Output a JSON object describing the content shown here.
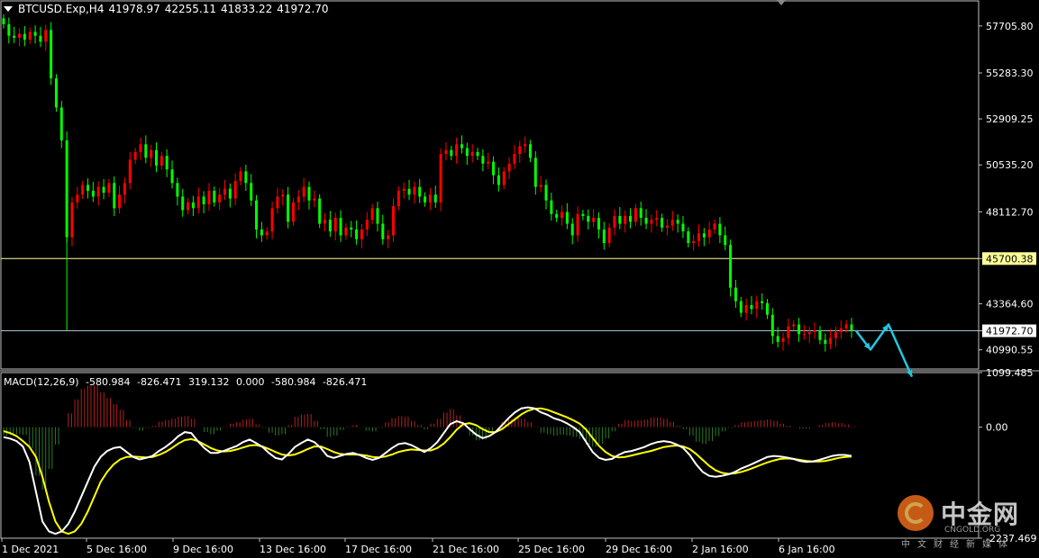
{
  "header": {
    "symbol": "BTCUSD.Exp,H4",
    "open": "41978.97",
    "high": "42255.11",
    "low": "41833.22",
    "close": "41972.70"
  },
  "macd_header": {
    "name": "MACD(12,26,9)",
    "v1": "-580.984",
    "v2": "-826.471",
    "v3": "319.132",
    "v4": "0.000",
    "v5": "-580.984",
    "v6": "-826.471"
  },
  "watermark": {
    "brand": "中金网",
    "site": "CNGOLD.ORG",
    "sub": "中文财经新媒体"
  },
  "colors": {
    "bull": "#ff0000",
    "bear": "#00ff00",
    "support": "#ffff99",
    "price_line": "#a0c0d0",
    "macd_line": "#ffffff",
    "signal_line": "#ffff00",
    "arrow": "#21c7e0",
    "axis_text": "#ffffff"
  },
  "chart_data": [
    {
      "type": "candlestick",
      "title": "BTCUSD.Exp,H4",
      "ylim": [
        40000,
        59000
      ],
      "y_ticks": [
        "57705.80",
        "55283.30",
        "52909.25",
        "50535.20",
        "48112.70",
        "45700.38",
        "43364.60",
        "41972.70",
        "40990.55"
      ],
      "y_tick_values": [
        57705.8,
        55283.3,
        52909.25,
        50535.2,
        48112.7,
        45700.38,
        43364.6,
        41972.7,
        40990.55
      ],
      "x_ticks": [
        "1 Dec 2021",
        "5 Dec 16:00",
        "9 Dec 16:00",
        "13 Dec 16:00",
        "17 Dec 16:00",
        "21 Dec 16:00",
        "25 Dec 16:00",
        "29 Dec 16:00",
        "2 Jan 16:00",
        "6 Jan 16:00"
      ],
      "support_level": 45700.38,
      "current_price": 41972.7,
      "close_series": [
        57800,
        57200,
        57100,
        57300,
        57000,
        57400,
        57200,
        56900,
        57500,
        55000,
        53500,
        51800,
        46800,
        48600,
        49000,
        49500,
        49200,
        48900,
        49400,
        49100,
        49600,
        48300,
        49000,
        49600,
        50800,
        51200,
        51600,
        50900,
        51300,
        50500,
        51000,
        50300,
        49600,
        48900,
        48200,
        48600,
        48300,
        48900,
        48500,
        49200,
        48600,
        49000,
        49300,
        48800,
        49700,
        50200,
        49600,
        48700,
        47200,
        46900,
        47100,
        48300,
        48900,
        49000,
        47600,
        48600,
        48900,
        49400,
        48700,
        48800,
        47500,
        47700,
        47100,
        47800,
        46900,
        47300,
        47200,
        46700,
        47200,
        47700,
        48300,
        47500,
        46700,
        46900,
        48400,
        49200,
        49300,
        49000,
        49400,
        48900,
        48600,
        49000,
        48600,
        51100,
        51300,
        51000,
        51600,
        51400,
        51000,
        51200,
        51000,
        50600,
        50700,
        50000,
        49500,
        50200,
        50600,
        51100,
        51500,
        51600,
        50900,
        49400,
        49500,
        48700,
        48000,
        47800,
        48100,
        47500,
        46900,
        48000,
        47900,
        47600,
        47800,
        47200,
        46500,
        47300,
        47900,
        47500,
        47900,
        47600,
        48300,
        47800,
        47500,
        47700,
        47800,
        47300,
        47400,
        47700,
        47500,
        47100,
        46500,
        46600,
        47000,
        46800,
        47200,
        47500,
        46900,
        46400,
        44200,
        43500,
        42900,
        43300,
        43100,
        43500,
        43400,
        42800,
        41700,
        41400,
        41600,
        42200,
        42300,
        41800,
        41800,
        41900,
        42000,
        41500,
        41300,
        41600,
        41900,
        42100,
        42300,
        42000
      ],
      "projection": [
        {
          "x": "6 Jan +",
          "y": 41972.7
        },
        {
          "x": "",
          "y": 41000
        },
        {
          "x": "",
          "y": 42300
        },
        {
          "x": "",
          "y": 39600
        }
      ]
    },
    {
      "type": "macd",
      "title": "MACD(12,26,9)",
      "ylim": [
        -2237.469,
        1099.485
      ],
      "y_ticks": [
        "1099.485",
        "0.00",
        "-2237.469"
      ],
      "y_tick_values": [
        1099.485,
        0,
        -2237.469
      ],
      "macd": [
        -200,
        -230,
        -280,
        -390,
        -700,
        -1300,
        -1900,
        -2100,
        -2150,
        -2100,
        -1950,
        -1700,
        -1400,
        -1100,
        -800,
        -600,
        -480,
        -420,
        -400,
        -500,
        -600,
        -650,
        -620,
        -580,
        -480,
        -400,
        -300,
        -180,
        -100,
        -120,
        -280,
        -420,
        -520,
        -520,
        -480,
        -430,
        -380,
        -300,
        -250,
        -320,
        -400,
        -520,
        -620,
        -650,
        -540,
        -400,
        -320,
        -250,
        -300,
        -420,
        -580,
        -620,
        -580,
        -540,
        -520,
        -560,
        -620,
        -660,
        -620,
        -520,
        -420,
        -340,
        -320,
        -360,
        -430,
        -500,
        -420,
        -300,
        -120,
        60,
        120,
        80,
        -40,
        -150,
        -220,
        -180,
        -100,
        40,
        180,
        300,
        380,
        400,
        380,
        300,
        250,
        180,
        140,
        80,
        0,
        -100,
        -300,
        -500,
        -620,
        -660,
        -640,
        -560,
        -500,
        -480,
        -440,
        -400,
        -340,
        -300,
        -280,
        -300,
        -350,
        -420,
        -560,
        -750,
        -900,
        -980,
        -1000,
        -980,
        -950,
        -900,
        -830,
        -780,
        -720,
        -660,
        -600,
        -580,
        -590,
        -610,
        -640,
        -680,
        -700,
        -690,
        -660,
        -620,
        -580,
        -560,
        -560,
        -580
      ],
      "signal": [
        -80,
        -120,
        -180,
        -280,
        -400,
        -600,
        -1000,
        -1500,
        -1900,
        -2100,
        -2150,
        -2100,
        -1950,
        -1700,
        -1400,
        -1100,
        -900,
        -750,
        -650,
        -600,
        -590,
        -600,
        -610,
        -600,
        -560,
        -500,
        -420,
        -330,
        -260,
        -240,
        -280,
        -350,
        -420,
        -470,
        -490,
        -480,
        -450,
        -410,
        -370,
        -360,
        -390,
        -440,
        -500,
        -550,
        -570,
        -550,
        -500,
        -440,
        -390,
        -390,
        -440,
        -500,
        -540,
        -550,
        -550,
        -555,
        -570,
        -600,
        -610,
        -590,
        -550,
        -500,
        -470,
        -450,
        -460,
        -470,
        -470,
        -420,
        -330,
        -200,
        -50,
        60,
        80,
        40,
        -40,
        -100,
        -100,
        -40,
        60,
        160,
        260,
        330,
        370,
        380,
        350,
        300,
        250,
        200,
        140,
        70,
        -50,
        -220,
        -380,
        -500,
        -580,
        -610,
        -600,
        -570,
        -540,
        -510,
        -480,
        -440,
        -400,
        -380,
        -370,
        -390,
        -440,
        -540,
        -660,
        -780,
        -870,
        -920,
        -940,
        -930,
        -900,
        -860,
        -810,
        -760,
        -710,
        -670,
        -640,
        -630,
        -640,
        -660,
        -680,
        -690,
        -690,
        -680,
        -650,
        -620,
        -600,
        -590
      ]
    }
  ]
}
